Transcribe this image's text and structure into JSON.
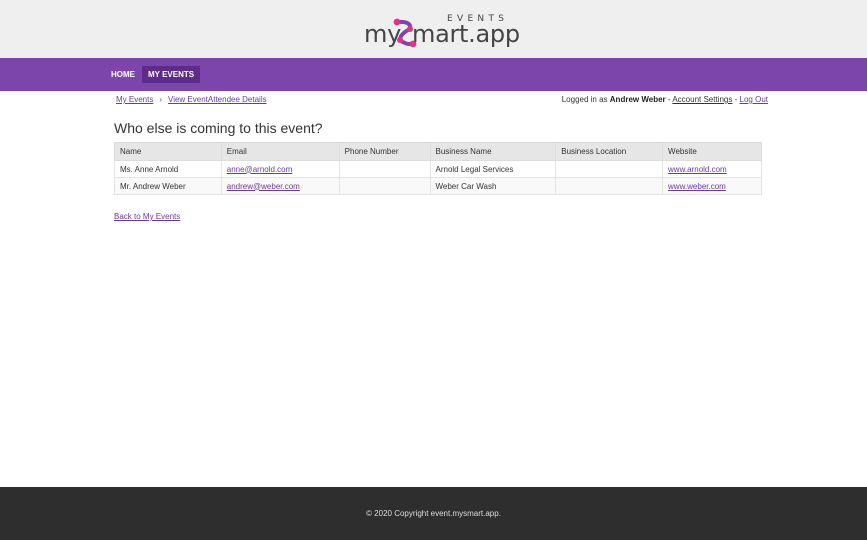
{
  "brand": {
    "tagline": "EVENTS",
    "word_left": "my",
    "word_right": "mart.app",
    "accent_color": "#7b45ab",
    "logo_icon_color": "#e0348a"
  },
  "nav": {
    "items": [
      {
        "label": "HOME"
      },
      {
        "label": "MY EVENTS"
      }
    ]
  },
  "breadcrumb": {
    "items": [
      "My Events",
      "View EventAttendee Details"
    ],
    "separator": "›"
  },
  "user": {
    "prefix": "Logged in as",
    "name": "Andrew Weber",
    "dash": "-",
    "settings_label": "Account Settings",
    "logout_label": "Log Out"
  },
  "page": {
    "title": "Who else is coming to this event?",
    "back_label": "Back to My Events"
  },
  "table": {
    "columns": [
      "Name",
      "Email",
      "Phone Number",
      "Business Name",
      "Business Location",
      "Website"
    ],
    "rows": [
      {
        "name": "Ms. Anne Arnold",
        "email": "anne@arnold.com",
        "phone": "",
        "business": "Arnold Legal Services",
        "location": "",
        "website": "www.arnold.com"
      },
      {
        "name": "Mr. Andrew Weber",
        "email": "andrew@weber.com",
        "phone": "",
        "business": "Weber Car Wash",
        "location": "",
        "website": "www.weber.com"
      }
    ]
  },
  "footer": {
    "text": "© 2020 Copyright event.mysmart.app."
  }
}
